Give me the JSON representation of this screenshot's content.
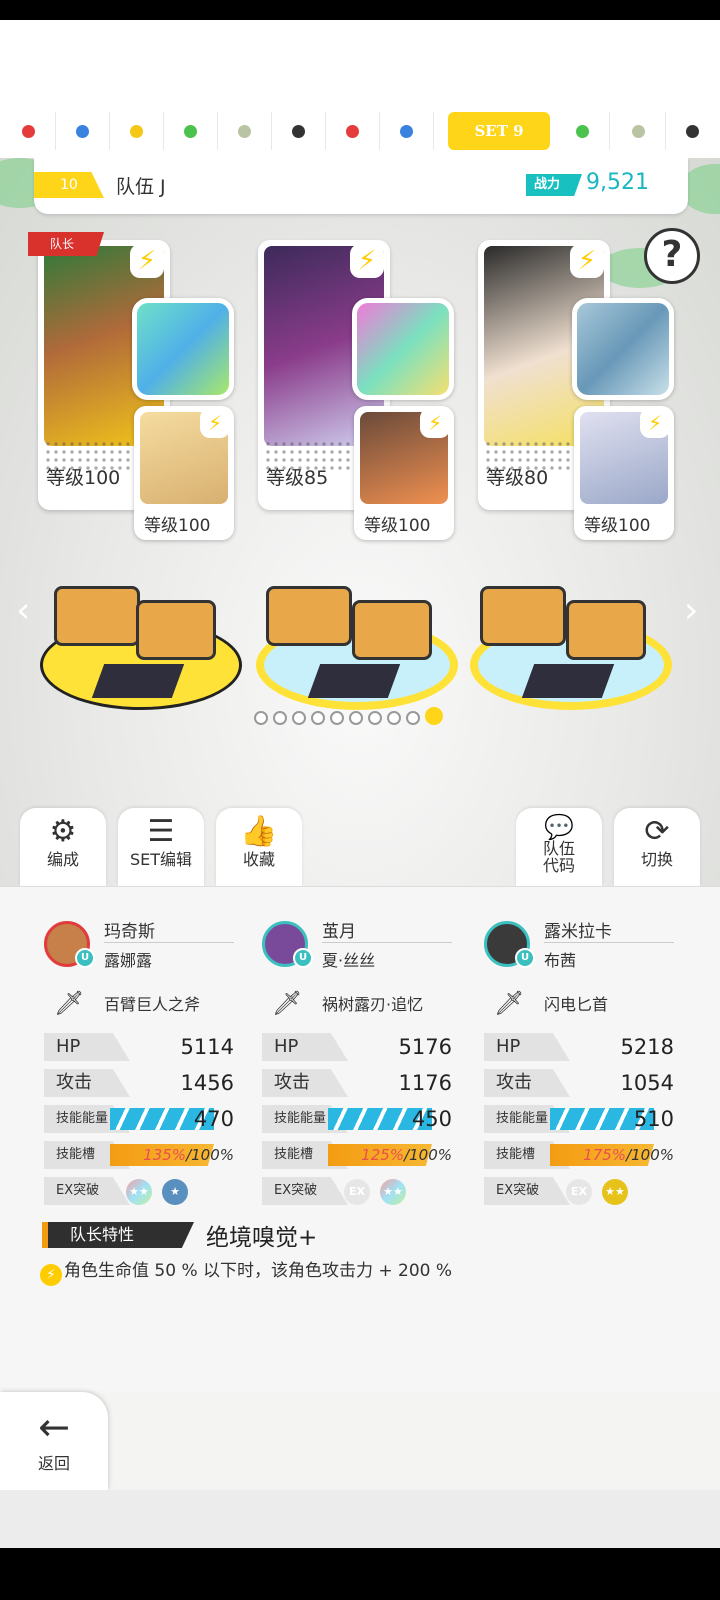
{
  "set_tabs": [
    {
      "color": "#e53b3b"
    },
    {
      "color": "#3a82e0"
    },
    {
      "color": "#f5c816"
    },
    {
      "color": "#4bc24b"
    },
    {
      "color": "#b9c4a4"
    },
    {
      "color": "#333333"
    },
    {
      "color": "#e53b3b"
    },
    {
      "color": "#3a82e0"
    },
    {
      "label": "SET 9",
      "active": true
    },
    {
      "color": "#4bc24b"
    },
    {
      "color": "#b9c4a4"
    },
    {
      "color": "#333333"
    }
  ],
  "team": {
    "number": "10",
    "name": "队伍 J",
    "power_label": "战力",
    "power_value": "9,521"
  },
  "help_icon": "?",
  "leader_tag": "队长",
  "characters": [
    {
      "level": "等级100",
      "sub_level": "等级100"
    },
    {
      "level": "等级85",
      "sub_level": "等级100"
    },
    {
      "level": "等级80",
      "sub_level": "等级100"
    }
  ],
  "page_dots": {
    "count": 10,
    "active": 9
  },
  "actions": {
    "formation": "编成",
    "set_edit": "SET编辑",
    "favorite": "收藏",
    "team_code": "队伍\n代码",
    "switch": "切换"
  },
  "stat_labels": {
    "hp": "HP",
    "atk": "攻击",
    "energy": "技能能量",
    "slot": "技能槽",
    "ex": "EX突破"
  },
  "details": [
    {
      "name": "玛奇斯",
      "sub": "露娜露",
      "weapon": "百臂巨人之斧",
      "hp": "5114",
      "atk": "1456",
      "energy": "470",
      "slot_pct": "135%",
      "slot_max": "/100%"
    },
    {
      "name": "茧月",
      "sub": "夏·丝丝",
      "weapon": "祸树露刃·追忆",
      "hp": "5176",
      "atk": "1176",
      "energy": "450",
      "slot_pct": "125%",
      "slot_max": "/100%"
    },
    {
      "name": "露米拉卡",
      "sub": "布茜",
      "weapon": "闪电匕首",
      "hp": "5218",
      "atk": "1054",
      "energy": "510",
      "slot_pct": "175%",
      "slot_max": "/100%"
    }
  ],
  "leader_skill": {
    "label": "队长特性",
    "name": "绝境嗅觉+",
    "description": "角色生命值 50 % 以下时，该角色攻击力 + 200 %"
  },
  "back_label": "返回"
}
